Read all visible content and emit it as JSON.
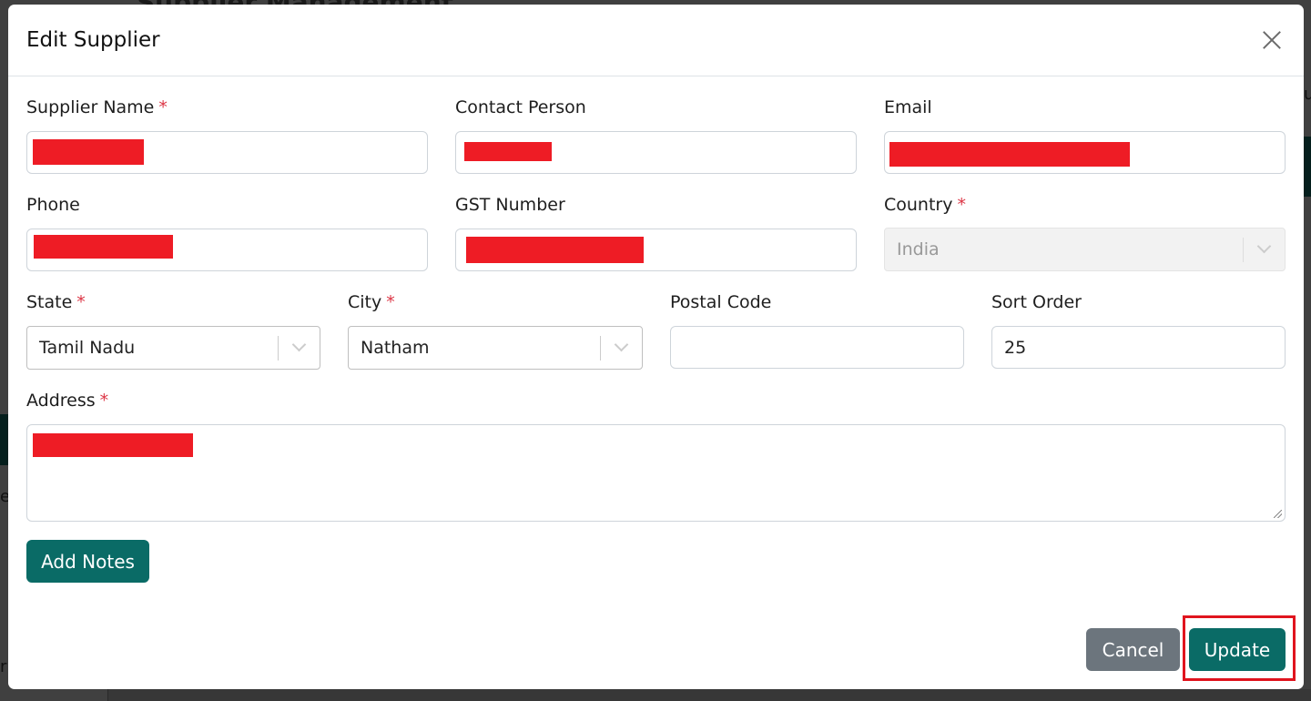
{
  "background": {
    "page_title": "Supplier Management"
  },
  "modal": {
    "title": "Edit Supplier",
    "fields": {
      "supplier_name": {
        "label": "Supplier Name",
        "required": "*"
      },
      "contact_person": {
        "label": "Contact Person"
      },
      "email": {
        "label": "Email"
      },
      "phone": {
        "label": "Phone"
      },
      "gst_number": {
        "label": "GST Number"
      },
      "country": {
        "label": "Country",
        "required": "*",
        "value": "India"
      },
      "state": {
        "label": "State",
        "required": "*",
        "value": "Tamil Nadu"
      },
      "city": {
        "label": "City",
        "required": "*",
        "value": "Natham"
      },
      "postal_code": {
        "label": "Postal Code",
        "value": ""
      },
      "sort_order": {
        "label": "Sort Order",
        "value": "25"
      },
      "address": {
        "label": "Address",
        "required": "*"
      }
    },
    "add_notes_label": "Add Notes",
    "cancel_label": "Cancel",
    "update_label": "Update"
  },
  "colors": {
    "primary": "#0a6b66",
    "secondary": "#6c757d",
    "required": "#dc3545",
    "redaction": "#ee1c25",
    "highlight": "#e0141e"
  }
}
